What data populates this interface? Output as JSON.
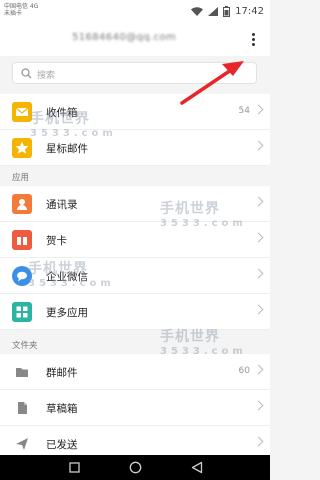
{
  "statusbar": {
    "carrier_line1": "中国电信 4G",
    "carrier_line2": "未插卡",
    "time": "17:42"
  },
  "header": {
    "account": "51684640@qq.com"
  },
  "search": {
    "placeholder": "搜索"
  },
  "mailboxes": [
    {
      "label": "收件箱",
      "count": "54",
      "icon": "inbox-icon",
      "color": "#f5b400"
    },
    {
      "label": "星标邮件",
      "count": "",
      "icon": "star-icon",
      "color": "#f5b400"
    }
  ],
  "apps_section": {
    "title": "应用"
  },
  "apps": [
    {
      "label": "通讯录",
      "icon": "contacts-icon",
      "color": "#f27b3a"
    },
    {
      "label": "贺卡",
      "icon": "card-icon",
      "color": "#ef5b40"
    },
    {
      "label": "企业微信",
      "icon": "wework-icon",
      "color": "#3a8fe6"
    },
    {
      "label": "更多应用",
      "icon": "grid-icon",
      "color": "#2bb3a3"
    }
  ],
  "folders_section": {
    "title": "文件夹"
  },
  "folders": [
    {
      "label": "群邮件",
      "count": "60",
      "icon": "folder-icon"
    },
    {
      "label": "草稿箱",
      "count": "",
      "icon": "draft-icon"
    },
    {
      "label": "已发送",
      "count": "",
      "icon": "sent-icon"
    }
  ],
  "watermark": {
    "text": "手机世界",
    "number": "3533.com"
  },
  "colors": {
    "arrow": "#e8262a",
    "background": "#f4f4f4"
  }
}
